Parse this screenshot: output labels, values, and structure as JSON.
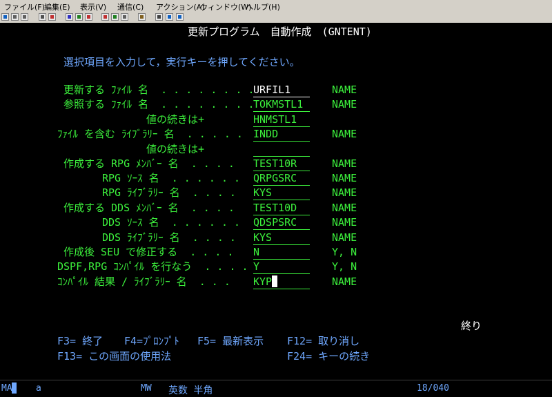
{
  "menu": [
    "ファイル(F)",
    "編集(E)",
    "表示(V)",
    "通信(C)",
    "アクション(A)",
    "ウィンドウ(W)",
    "ヘルプ(H)"
  ],
  "toolbar": {
    "buttons": [
      {
        "icon": "screen-icon",
        "color": "#1060c0"
      },
      {
        "icon": "copy-icon",
        "color": "#606060"
      },
      {
        "icon": "paste-icon",
        "color": "#606060"
      },
      {
        "icon": "print-icon",
        "color": "#505050"
      },
      {
        "icon": "send-icon",
        "color": "#c03030"
      },
      {
        "icon": "receive-icon",
        "color": "#3030c0"
      },
      {
        "icon": "macro-icon",
        "color": "#208020"
      },
      {
        "icon": "record-icon",
        "color": "#c03030"
      },
      {
        "icon": "stop-icon",
        "color": "#c03030"
      },
      {
        "icon": "play-icon",
        "color": "#208020"
      },
      {
        "icon": "keypad-icon",
        "color": "#606060"
      },
      {
        "icon": "settings-icon",
        "color": "#806020"
      },
      {
        "icon": "document-icon",
        "color": "#404040"
      },
      {
        "icon": "globe-icon",
        "color": "#1060c0"
      },
      {
        "icon": "help-icon",
        "color": "#1060c0"
      }
    ]
  },
  "screen": {
    "title": "更新プログラム　自動作成　(GNTENT)",
    "instruction": "選択項目を入力して，実行キーを押してください。",
    "fields": [
      {
        "label": "更新する ﾌｧｲﾙ 名  . . . . . . . .",
        "value": "URFIL1",
        "hint": "NAME"
      },
      {
        "label": "参照する ﾌｧｲﾙ 名  . . . . . . . .",
        "value": "TOKMSTL1",
        "hint": "NAME"
      },
      {
        "label": "値の続きは+",
        "value": "HNMSTL1",
        "hint": ""
      },
      {
        "label": "ﾌｧｲﾙ を含む ﾗｲﾌﾞﾗﾘｰ 名  . . . . .",
        "value": "INDD",
        "hint": "NAME"
      },
      {
        "label": "値の続きは+",
        "value": "",
        "hint": ""
      },
      {
        "label": "作成する RPG ﾒﾝﾊﾞｰ 名  . . . .",
        "value": "TEST10R",
        "hint": "NAME"
      },
      {
        "label": "RPG ｿｰｽ 名  . . . . . .",
        "value": "QRPGSRC",
        "hint": "NAME"
      },
      {
        "label": "RPG ﾗｲﾌﾞﾗﾘｰ 名  . . . .",
        "value": "KYS",
        "hint": "NAME"
      },
      {
        "label": "作成する DDS ﾒﾝﾊﾞｰ 名  . . . .",
        "value": "TEST10D",
        "hint": "NAME"
      },
      {
        "label": "DDS ｿｰｽ 名  . . . . . .",
        "value": "QDSPSRC",
        "hint": "NAME"
      },
      {
        "label": "DDS ﾗｲﾌﾞﾗﾘｰ 名  . . . .",
        "value": "KYS",
        "hint": "NAME"
      },
      {
        "label": "作成後 SEU で修正する  . . . .",
        "value": "N",
        "hint": "Y, N"
      },
      {
        "label": "DSPF,RPG ｺﾝﾊﾟｲﾙ を行なう  . . . .",
        "value": "Y",
        "hint": "Y, N"
      },
      {
        "label": "ｺﾝﾊﾟｲﾙ 結果 / ﾗｲﾌﾞﾗﾘｰ 名  . . .",
        "value": "KYP",
        "hint": "NAME"
      }
    ],
    "more": "終り",
    "fkeys": [
      "F3= 終了",
      "F4=ﾌﾟﾛﾝﾌﾟﾄ",
      "F5= 最新表示",
      "F12= 取り消し",
      "F13= この画面の使用法",
      "F24= キーの続き"
    ]
  },
  "status": {
    "mode": "MA",
    "session": "a",
    "mw": "MW",
    "input_mode": "英数 半角",
    "cursor_pos": "18/040"
  }
}
